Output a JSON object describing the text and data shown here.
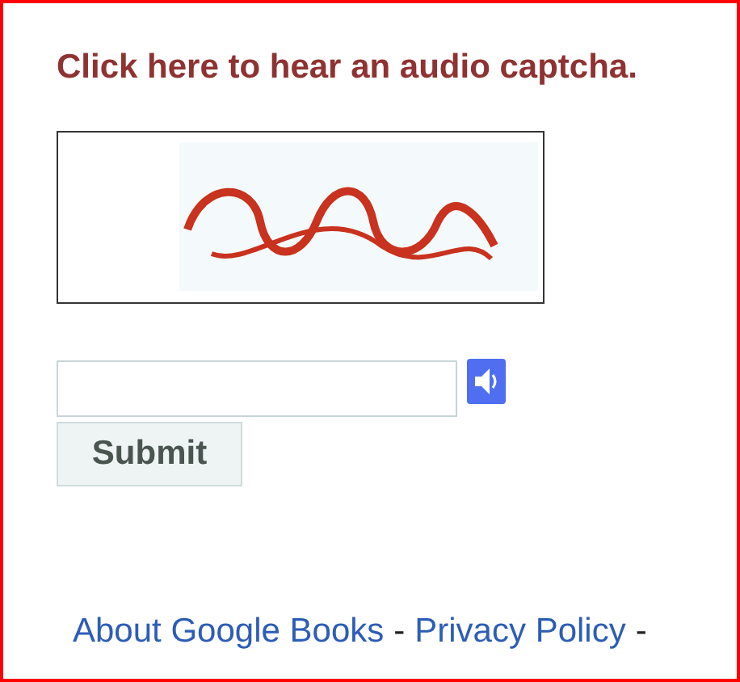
{
  "audio_link": "Click here to hear an audio captcha.",
  "submit": "Submit",
  "footer": [
    {
      "kind": "link",
      "text": "About Google Books"
    },
    {
      "kind": "separator",
      "text": "-"
    },
    {
      "kind": "link",
      "text": "Privacy Policy"
    },
    {
      "kind": "separator",
      "text": "-"
    }
  ]
}
